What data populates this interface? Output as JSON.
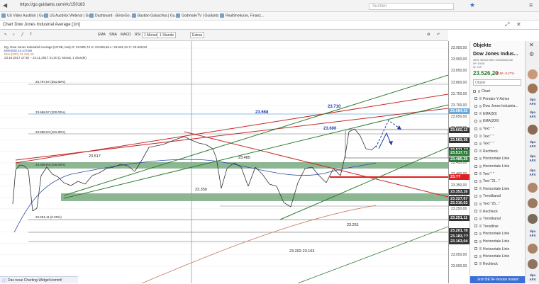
{
  "browser": {
    "url": "https://go.guidants.com/#c/150183",
    "search_placeholder": "Suchen",
    "bookmarks": [
      "US Video Ausblick | Gu...",
      "US Ausblick Webinar | Gu...",
      "Dashboard - BörseGo ...",
      "Bastian Galuschka | Gu...",
      "GodmodeTV | Guidants",
      "Realtimekurse, Finanz..."
    ]
  },
  "tab": {
    "title": "Chart Dow Jones Industrial Average [1m]"
  },
  "toolbar": {
    "buttons": [
      "EMA",
      "SMA",
      "MACD",
      "RSI",
      "1 Monat",
      "1 Stunde",
      "Extras"
    ]
  },
  "legend": {
    "line1": "Ng. Dow Jones Industrial Average (NYSE, last)  O: 23.505,74  H: 23.529,66  L: 23.501,31  C: 23.529,52",
    "line2": "EMA(50)  23.473,69",
    "line3": "EMA(200)  23.168,40",
    "line4": "23.10.2017 17:30 – 22.11.2017 21:30  (1 Monat, 1 Stunde)"
  },
  "annotations": {
    "fib_2618": "23.797,57 (261.80%)",
    "fib_200": "23.668,57 (200.00%)",
    "fib_1618": "23.588,04 (161.80%)",
    "fib_100": "23.459,54 (100.00%)",
    "fib_0": "23.251,11 (0.00%)",
    "level_23517": "23.517",
    "level_23485": "23.485",
    "level_23350": "23.350",
    "level_23251": "23.251",
    "level_range": "23.202-23.163",
    "target_23668": "23.668",
    "target_23710": "23.710",
    "target_23600": "23.600"
  },
  "yaxis": {
    "labels": [
      "23.950,00",
      "23.900,00",
      "23.850,00",
      "23.800,00",
      "23.750,00",
      "23.700,00",
      "23.650,00",
      "23.600,00",
      "23.550,00",
      "23.500,00",
      "23.450,00",
      "23.400,00",
      "23.350,00",
      "23.300,00",
      "23.250,00",
      "23.200,00",
      "23.150,00",
      "23.100,00",
      "23.050,00",
      "23.000,00"
    ],
    "highlights": [
      "23.684,32",
      "23.602,12",
      "23.583,36",
      "23.571,??",
      "23.517,71",
      "23.485,25",
      "23.??",
      "23.353,16",
      "23.327,67",
      "23.310,02",
      "23.251,11",
      "23.201,78",
      "23.183,??",
      "23.163,04"
    ]
  },
  "panel": {
    "title": "Objekte",
    "instrument": "Dow Jones Indus...",
    "instrument_sub1": "WKN: 969420  ISIN: US2605661048",
    "instrument_sub2": "HP: NYSE",
    "instrument_sub3": "W: 1/1P",
    "price": "23.526,20",
    "change": "-64,56  -0,27%",
    "search_placeholder": "Objekt",
    "items": [
      "Chart",
      "Primäre Y-Achse",
      "Dow Jones Industria...",
      "EMA(50)",
      "EMA(200)",
      "Text \" \"",
      "Text \" \"",
      "Text \" \"",
      "Rechteck",
      "Horizontale Linie",
      "Horizontale Linie",
      "Text \" \"",
      "Text \"21...\"",
      "Horizontale Linie",
      "Trendkanal",
      "Text \"25...\"",
      "Rechteck",
      "Trendkanal",
      "Trendlinie",
      "Horizontale Linie",
      "Horizontale Linie",
      "Horizontale Linie",
      "Horizontale Linie",
      "Rechteck"
    ],
    "footer": "Jetzt BETA-Version testen!"
  },
  "status": {
    "text": "Das neue Charting-Widget kommt!"
  },
  "colors": {
    "green_channel": "#2e7d32",
    "red_channel": "#c62828",
    "fib_zone": "#2f7a3a",
    "blue_note": "#1f3fa8",
    "ema50": "#2a47b0",
    "ema200": "#c47a5a"
  }
}
